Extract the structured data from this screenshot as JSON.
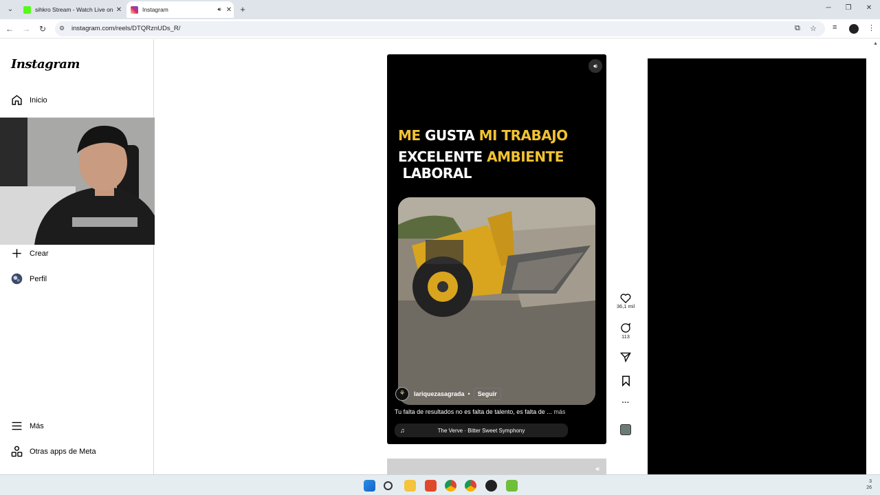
{
  "browser": {
    "tabs": [
      {
        "title": "sihkro Stream - Watch Live on Kick",
        "active": false,
        "favicon_color": "#53fc18"
      },
      {
        "title": "Instagram",
        "active": true,
        "favicon_color": "#e1306c"
      }
    ],
    "url": "instagram.com/reels/DTQRznUDs_R/"
  },
  "sidebar": {
    "logo": "Instagram",
    "items": [
      {
        "label": "Inicio",
        "icon": "home-icon"
      },
      {
        "label": "Crear",
        "icon": "plus-icon"
      },
      {
        "label": "Perfil",
        "icon": "profile-avatar-icon"
      },
      {
        "label": "Más",
        "icon": "menu-icon"
      },
      {
        "label": "Otras apps de Meta",
        "icon": "meta-apps-icon"
      }
    ]
  },
  "reel": {
    "headline_line1": [
      {
        "text": "ME",
        "color": "#f2c230"
      },
      {
        "text": " GUSTA ",
        "color": "#ffffff"
      },
      {
        "text": "MI TRABAJO",
        "color": "#f2c230"
      }
    ],
    "headline_line2": [
      {
        "text": "EXCELENTE ",
        "color": "#ffffff"
      },
      {
        "text": "AMBIENTE",
        "color": "#f2c230"
      },
      {
        "text": " LABORAL",
        "color": "#ffffff"
      }
    ],
    "author": "lariquezasagrada",
    "separator": "•",
    "follow_label": "Seguir",
    "caption": "Tu falta de resultados no es falta de talento, es falta de ...",
    "more_label": "más",
    "audio": "The Verve · Bitter Sweet Symphony"
  },
  "actions": {
    "likes": "36,1 mil",
    "comments": "113"
  },
  "tray": {
    "time": "3",
    "date": "26"
  },
  "colors": {
    "accent_yellow": "#f2c230",
    "sidebar_border": "#dbdbdb",
    "tab_strip": "#dfe3ea"
  }
}
